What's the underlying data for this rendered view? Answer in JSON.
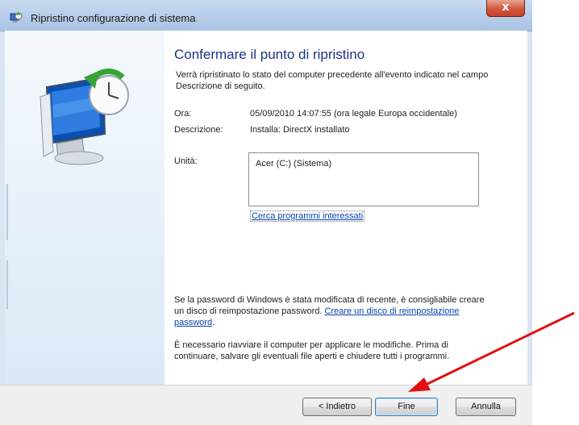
{
  "window": {
    "title": "Ripristino configurazione di sistema",
    "close_label": "x"
  },
  "content": {
    "heading": "Confermare il punto di ripristino",
    "intro": "Verrà ripristinato lo stato del computer precedente all'evento indicato nel campo Descrizione di seguito.",
    "time_label": "Ora:",
    "time_value": "05/09/2010 14:07:55 (ora legale Europa occidentale)",
    "description_label": "Descrizione:",
    "description_value": "Installa: DirectX installato",
    "drives_label": "Unità:",
    "drives": [
      "Acer (C:) (Sistema)"
    ],
    "scan_link": "Cerca programmi interessati",
    "password_text": "Se la password di Windows è stata modificata di recente, è consigliabile creare un disco di reimpostazione password.",
    "password_link": "Creare un disco di reimpostazione password",
    "password_tail": ".",
    "restart_text": "È necessario riavviare il computer per applicare le modifiche. Prima di continuare, salvare gli eventuali file aperti e chiudere tutti i programmi."
  },
  "buttons": {
    "back": "< Indietro",
    "finish": "Fine",
    "cancel": "Annulla"
  },
  "colors": {
    "heading": "#1e3287",
    "link": "#0645ad",
    "arrow": "#e01010"
  }
}
